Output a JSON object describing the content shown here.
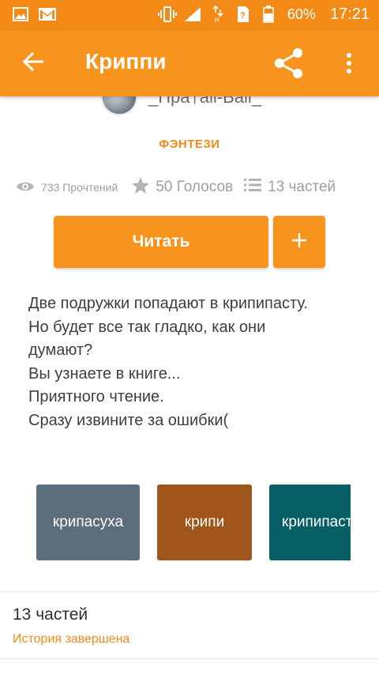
{
  "status_bar": {
    "battery_percent": "60%",
    "time": "17:21",
    "icons": [
      "gallery-icon",
      "gmail-icon",
      "vibrate-icon",
      "signal-icon",
      "data-icon",
      "sim-icon",
      "battery-icon"
    ]
  },
  "app_bar": {
    "title": "Криппи",
    "back_icon": "arrow-back-icon",
    "share_icon": "share-icon",
    "more_icon": "more-vert-icon"
  },
  "story": {
    "author": "_Пра†all-Ball_",
    "genre": "ФЭНТЕЗИ",
    "reads": "733 Прочтений",
    "votes": "50 Голосов",
    "parts": "13 частей",
    "read_label": "Читать",
    "add_label": "+",
    "description": [
      "Две подружки попадают в крипипасту.",
      "Но будет все так гладко, как они",
      "думают?",
      "Вы узнаете в книге...",
      "Приятного чтение.",
      "Сразу извините за ошибки("
    ]
  },
  "tags": [
    {
      "label": "крипасуха",
      "color": "#5a6e7b"
    },
    {
      "label": "крипи",
      "color": "#a0561a"
    },
    {
      "label": "крипипаста",
      "color": "#075f66"
    }
  ],
  "parts_section": {
    "title": "13 частей",
    "status": "История завершена"
  },
  "colors": {
    "accent": "#f7941e",
    "status_bar": "#f48a16",
    "muted": "#9e9e9e"
  }
}
